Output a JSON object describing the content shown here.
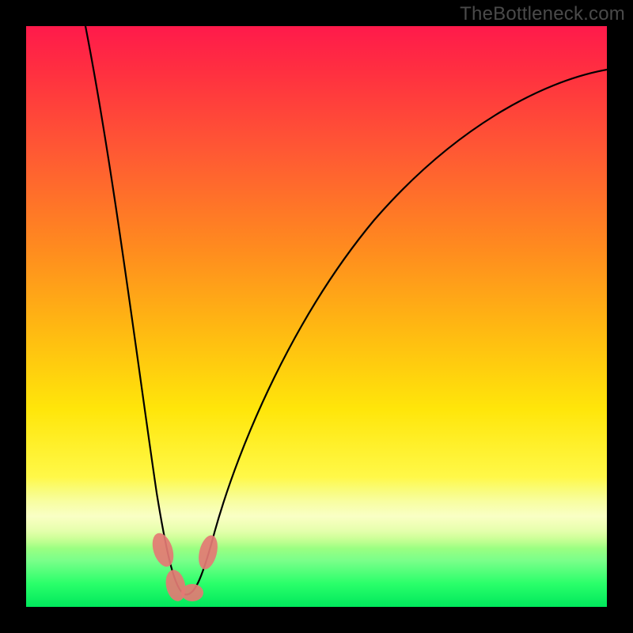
{
  "watermark": "TheBottleneck.com",
  "chart_data": {
    "type": "line",
    "title": "",
    "xlabel": "",
    "ylabel": "",
    "xlim": [
      0,
      100
    ],
    "ylim": [
      0,
      100
    ],
    "grid": false,
    "series": [
      {
        "name": "bottleneck-curve",
        "x": [
          10,
          15,
          20,
          23,
          26,
          28,
          30,
          35,
          45,
          60,
          80,
          100
        ],
        "y": [
          100,
          70,
          35,
          12,
          3,
          1,
          4,
          16,
          40,
          60,
          75,
          82
        ]
      }
    ],
    "markers": [
      {
        "x": 23.5,
        "y": 9
      },
      {
        "x": 25.5,
        "y": 3
      },
      {
        "x": 28.0,
        "y": 2.5
      },
      {
        "x": 30.5,
        "y": 9
      }
    ],
    "notes": "Values are read from pixel positions; chart has no visible axes, ticks, or legend."
  }
}
